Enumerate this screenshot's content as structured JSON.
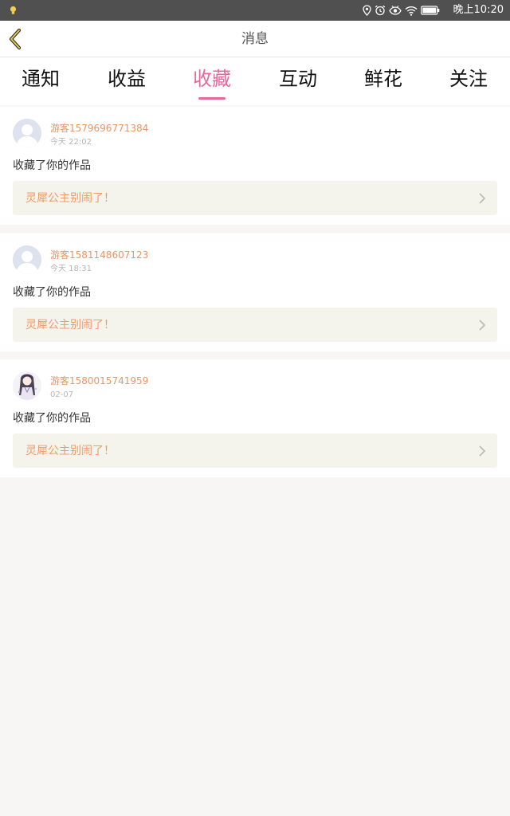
{
  "status_bar": {
    "time": "晚上10:20",
    "icons": [
      "bulb-icon",
      "location-icon",
      "alarm-icon",
      "eye-icon",
      "wifi-icon",
      "battery-icon"
    ]
  },
  "header": {
    "title": "消息",
    "back_icon": "chevron-left-icon"
  },
  "tabs": [
    {
      "label": "通知",
      "active": false
    },
    {
      "label": "收益",
      "active": false
    },
    {
      "label": "收藏",
      "active": true
    },
    {
      "label": "互动",
      "active": false
    },
    {
      "label": "鲜花",
      "active": false
    },
    {
      "label": "关注",
      "active": false
    }
  ],
  "messages": [
    {
      "username": "游客1579696771384",
      "timestamp": "今天 22:02",
      "action": "收藏了你的作品",
      "work_title": "灵犀公主别闹了！",
      "avatar": "default-avatar"
    },
    {
      "username": "游客1581148607123",
      "timestamp": "今天 18:31",
      "action": "收藏了你的作品",
      "work_title": "灵犀公主别闹了！",
      "avatar": "default-avatar"
    },
    {
      "username": "游客1580015741959",
      "timestamp": "02-07",
      "action": "收藏了你的作品",
      "work_title": "灵犀公主别闹了！",
      "avatar": "anime-character-avatar"
    }
  ],
  "colors": {
    "accent": "#e5699d",
    "username": "#e59667",
    "work_title": "#ee9a66",
    "work_link_bg": "#f5f4ec",
    "page_bg": "#f8f6f5",
    "status_bar_bg": "#505050"
  }
}
